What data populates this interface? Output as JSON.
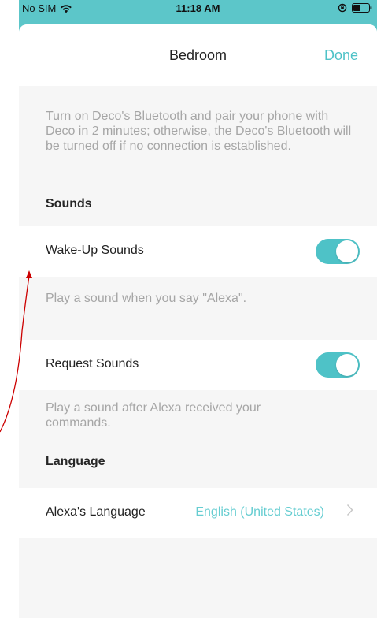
{
  "status_bar": {
    "carrier": "No SIM",
    "time": "11:18 AM"
  },
  "nav": {
    "title": "Bedroom",
    "done_label": "Done"
  },
  "bluetooth_description": "Turn on Deco's Bluetooth and pair your phone with Deco in 2 minutes; otherwise, the Deco's Bluetooth will be turned off if no connection is established.",
  "sounds": {
    "header": "Sounds",
    "wake_up": {
      "label": "Wake-Up Sounds",
      "enabled": true,
      "description": "Play a sound when you say \"Alexa\"."
    },
    "request": {
      "label": "Request Sounds",
      "enabled": true,
      "description": "Play a sound after Alexa received your commands."
    }
  },
  "language": {
    "header": "Language",
    "row_label": "Alexa's Language",
    "value": "English (United States)"
  },
  "colors": {
    "accent": "#4ec2c7",
    "status_bar_bg": "#5cc6c9",
    "annotation_arrow": "#cc0000"
  }
}
